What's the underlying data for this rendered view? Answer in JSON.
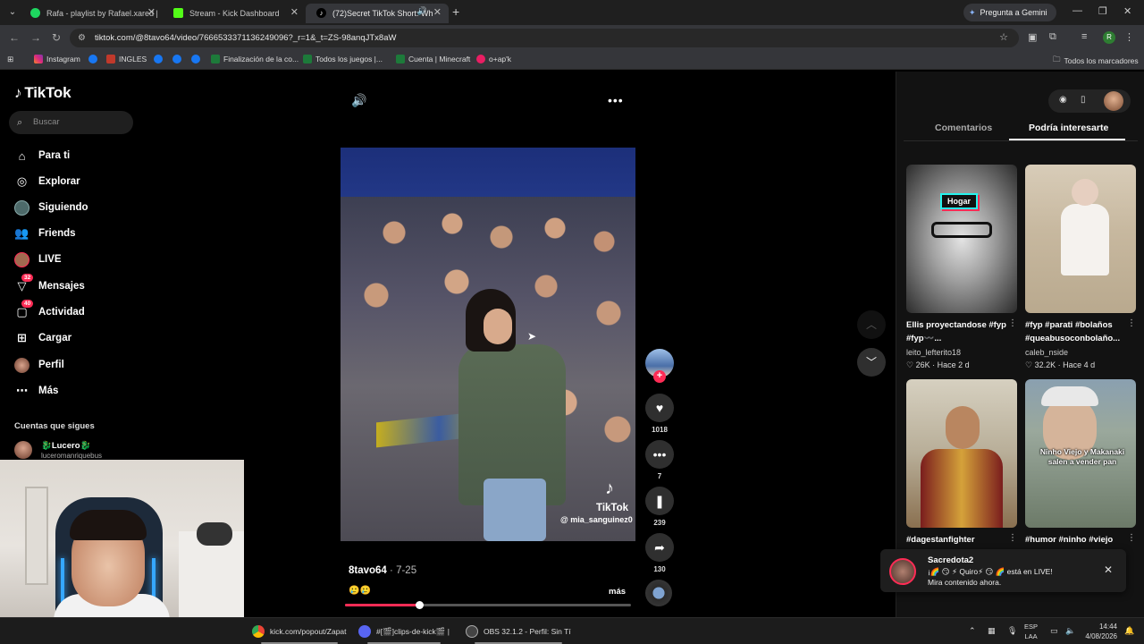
{
  "browser": {
    "tabs": [
      {
        "title": "Rafa - playlist by Rafael.xared |",
        "active": false,
        "favicon_color": "#1ed760"
      },
      {
        "title": "Stream - Kick Dashboard",
        "active": false,
        "favicon_color": "#53fc18"
      },
      {
        "title": "(72)Secret TikTok Short: Wh",
        "active": true,
        "favicon_color": "#ffffff"
      }
    ],
    "gemini_label": "Pregunta a Gemini",
    "url": "tiktok.com/@8tavo64/video/7666533371136249096?_r=1&_t=ZS-98anqJTx8aW",
    "profile_initial": "R",
    "bookmarks": [
      {
        "label": "Instagram",
        "icon": "instagram-icon"
      },
      {
        "label": "",
        "icon": "facebook-icon"
      },
      {
        "label": "INGLES",
        "icon": "folder-icon"
      },
      {
        "label": "",
        "icon": "facebook-icon"
      },
      {
        "label": "",
        "icon": "facebook-icon"
      },
      {
        "label": "",
        "icon": "facebook-icon"
      },
      {
        "label": "Finalización de la co...",
        "icon": "excel-icon"
      },
      {
        "label": "Todos los juegos |...",
        "icon": "excel-icon"
      },
      {
        "label": "Cuenta | Minecraft",
        "icon": "excel-icon"
      },
      {
        "label": "o+ap'k",
        "icon": "app-icon"
      }
    ],
    "all_bookmarks": "Todos los marcadores"
  },
  "tiktok": {
    "logo": "TikTok",
    "search_placeholder": "Buscar",
    "nav": [
      {
        "label": "Para ti",
        "icon": "home-icon"
      },
      {
        "label": "Explorar",
        "icon": "compass-icon"
      },
      {
        "label": "Siguiendo",
        "icon": "following-icon"
      },
      {
        "label": "Friends",
        "icon": "friends-icon"
      },
      {
        "label": "LIVE",
        "icon": "live-icon"
      },
      {
        "label": "Mensajes",
        "icon": "messages-icon",
        "badge": "32"
      },
      {
        "label": "Actividad",
        "icon": "activity-icon",
        "badge": "40"
      },
      {
        "label": "Cargar",
        "icon": "upload-icon"
      },
      {
        "label": "Perfil",
        "icon": "profile-icon"
      },
      {
        "label": "Más",
        "icon": "more-icon"
      }
    ],
    "following_header": "Cuentas que sigues",
    "following": [
      {
        "name": "🐉Lucero🐉",
        "handle": "luceromanriquebus"
      }
    ],
    "video": {
      "author": "8tavo64",
      "date": "7-25",
      "caption": "🥲🥲",
      "more": "más",
      "watermark_name": "TikTok",
      "watermark_user": "@ mia_sanguinez0",
      "progress": 0.26,
      "likes": "1018",
      "comments": "7",
      "saves": "239",
      "shares": "130"
    },
    "right": {
      "tabs": [
        "Comentarios",
        "Podría interesarte"
      ],
      "active_tab": 1,
      "cards": [
        {
          "caption": "Ellis proyectandose #fyp #fyp〰️...",
          "user": "leito_lefterito18",
          "likes": "26K",
          "age": "Hace 2 d",
          "badge": "Hogar"
        },
        {
          "caption": "#fyp #parati #bolaños #queabusoconbolaño...",
          "user": "caleb_nside",
          "likes": "32.2K",
          "age": "Hace 4 d"
        },
        {
          "caption": "#dagestanfighter",
          "user": "",
          "likes": "",
          "age": ""
        },
        {
          "caption": "#humor #ninho #viejo",
          "user": "",
          "likes": "",
          "age": "",
          "overlay": "Ninho Viejo y Makanaki salen a vender pan"
        }
      ]
    },
    "toast": {
      "name": "Sacredota2",
      "message": "¡🌈 😏 ⚡ Quiro⚡ 😏 🌈 está en LIVE!",
      "sub": "Mira contenido ahora."
    }
  },
  "taskbar": {
    "items": [
      {
        "label": "kick.com/popout/Zapat",
        "icon": "chrome-icon",
        "color": "#4285f4"
      },
      {
        "label": "#[🎬]clips-de-kick🎬 |",
        "icon": "discord-icon",
        "color": "#5865f2"
      },
      {
        "label": "OBS 32.1.2 - Perfil: Sin Tí",
        "icon": "obs-icon",
        "color": "#444444"
      }
    ],
    "lang_top": "ESP",
    "lang_bottom": "LAA",
    "time": "14:44",
    "date": "4/08/2026"
  }
}
